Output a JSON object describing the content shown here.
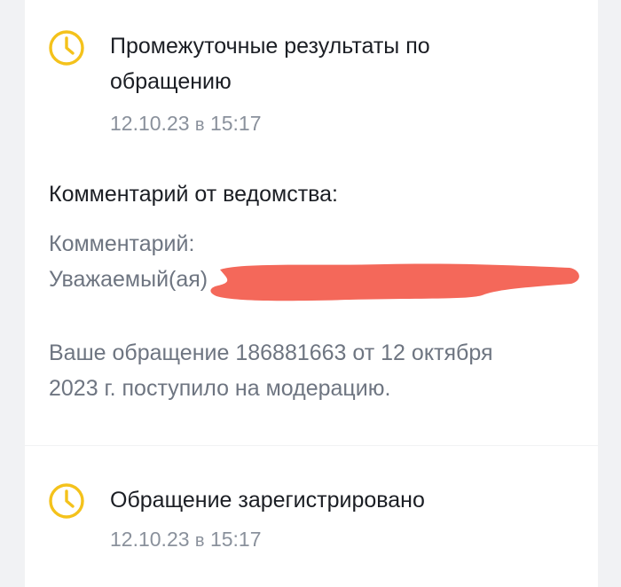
{
  "events": [
    {
      "title_line1": "Промежуточные результаты по",
      "title_line2": "обращению",
      "date": "12.10.23",
      "sep": "в",
      "time": "15:17",
      "icon": "clock-icon"
    },
    {
      "title_line1": "Обращение зарегистрировано",
      "date": "12.10.23",
      "sep": "в",
      "time": "15:17",
      "icon": "clock-icon"
    }
  ],
  "comment": {
    "heading": "Комментарий от ведомства:",
    "label": "Комментарий:",
    "greeting": "Уважаемый(ая)",
    "message_line1": "Ваше обращение 186881663 от 12 октября",
    "message_line2": "2023 г. поступило на модерацию."
  },
  "colors": {
    "icon": "#f4c21b",
    "redaction": "#f4685a",
    "title": "#1b1e24",
    "muted": "#8a919c"
  }
}
